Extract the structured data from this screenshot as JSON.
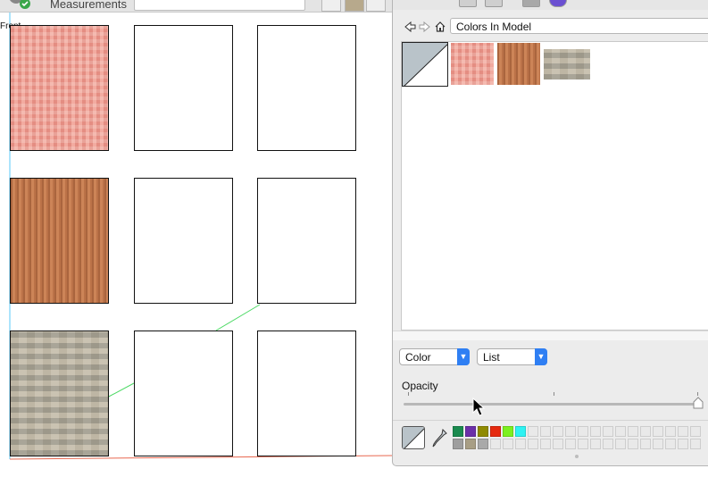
{
  "toolbar": {
    "measurements_label": "Measurements",
    "measurements_value": ""
  },
  "viewport": {
    "view_label": "Front",
    "axis_colors": {
      "red": "#e8674f",
      "green": "#4cd964",
      "blue": "#5ac8fa"
    },
    "faces": [
      {
        "material": "pink"
      },
      {
        "material": "none"
      },
      {
        "material": "none"
      },
      {
        "material": "wood"
      },
      {
        "material": "none"
      },
      {
        "material": "none"
      },
      {
        "material": "stone"
      },
      {
        "material": "none"
      },
      {
        "material": "none"
      }
    ]
  },
  "materials_panel": {
    "nav": {
      "back_icon": "arrow-left-icon",
      "forward_icon": "arrow-right-icon",
      "home_icon": "home-icon"
    },
    "collection_value": "Colors In Model",
    "swatches": [
      {
        "name": "default-material",
        "color": "#b9c3c9"
      },
      {
        "name": "pink-pattern",
        "color": "#ee9e92"
      },
      {
        "name": "wood",
        "color": "#c47b4f"
      },
      {
        "name": "stone",
        "color": "#b8b2a3"
      }
    ],
    "mode_select": "Color",
    "view_select": "List",
    "opacity_label": "Opacity",
    "opacity_value": 1.0,
    "palette_row1": [
      "#1a8a4e",
      "#6b2fa8",
      "#8f8a00",
      "#e5290e",
      "#7cf01f",
      "#2ef2f2"
    ],
    "palette_row2": [
      "#9e9e9e",
      "#a89e85",
      "#a9a9a9"
    ],
    "empty_cells": 14
  }
}
